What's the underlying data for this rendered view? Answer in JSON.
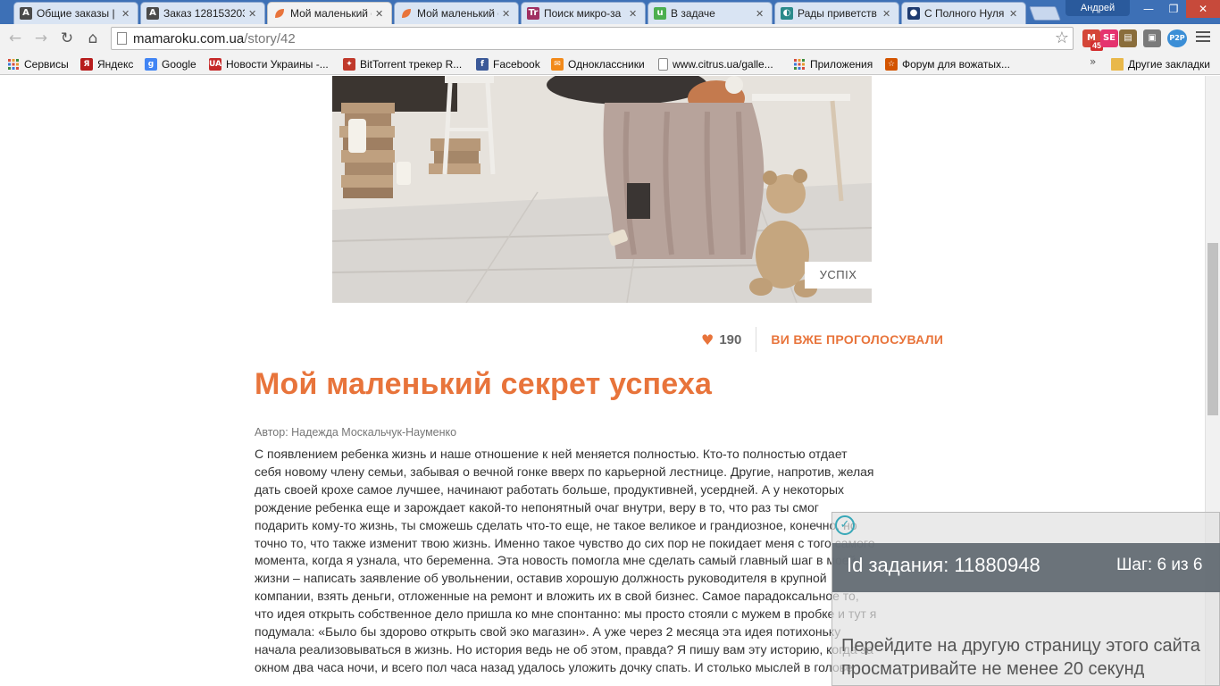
{
  "browser": {
    "tabs": [
      {
        "title": "Общие заказы | ",
        "icon": "A",
        "color": "#4a4a4a",
        "active": false
      },
      {
        "title": "Заказ 128153203",
        "icon": "A",
        "color": "#4a4a4a",
        "active": false
      },
      {
        "title": "Мой маленький с",
        "icon": "leaf",
        "color": "#e8743b",
        "active": true
      },
      {
        "title": "Мой маленький с",
        "icon": "leaf",
        "color": "#e8743b",
        "active": false
      },
      {
        "title": "Поиск микро-за",
        "icon": "Tr",
        "color": "#a03062",
        "active": false
      },
      {
        "title": "В задаче",
        "icon": "u",
        "color": "#4caf50",
        "active": false
      },
      {
        "title": "Рады приветств",
        "icon": "◐",
        "color": "#2a8a8a",
        "active": false
      },
      {
        "title": "С Полного Нуля",
        "icon": "●",
        "color": "#1e3b70",
        "active": false
      }
    ],
    "profile_name": "Андрей",
    "url_host": "mamaroku.com.ua",
    "url_path": "/story/42",
    "extensions": [
      {
        "label": "M",
        "color": "#d44638",
        "badge": "45"
      },
      {
        "label": "SE",
        "color": "#e5336f",
        "badge": ""
      },
      {
        "label": "▤",
        "color": "#8a6d3b",
        "badge": ""
      },
      {
        "label": "▣",
        "color": "#7a7a7a",
        "badge": ""
      },
      {
        "label": "P2P",
        "color": "#3b8ed6",
        "badge": ""
      }
    ],
    "bookmarks": [
      {
        "label": "Сервисы",
        "icon": "grid",
        "color": "#d54b3d"
      },
      {
        "label": "Яндекс",
        "icon": "Я",
        "color": "#b71c1c"
      },
      {
        "label": "Google",
        "icon": "g",
        "color": "#4285f4"
      },
      {
        "label": "Новости Украины -...",
        "icon": "UA",
        "color": "#c62828"
      },
      {
        "label": "BitTorrent трекер R...",
        "icon": "✦",
        "color": "#c0392b"
      },
      {
        "label": "Facebook",
        "icon": "f",
        "color": "#3b5998"
      },
      {
        "label": "Одноклассники",
        "icon": "✉",
        "color": "#f28a1a"
      },
      {
        "label": "www.citrus.ua/galle...",
        "icon": "doc",
        "color": "#ffffff"
      },
      {
        "label": "Приложения",
        "icon": "grid",
        "color": "#d54b3d"
      },
      {
        "label": "Форум для вожатых...",
        "icon": "☆",
        "color": "#d35400"
      }
    ],
    "bookmarks_more": "»",
    "other_bookmarks": "Другие закладки"
  },
  "story": {
    "tag": "УСПІХ",
    "votes": "190",
    "voted_label": "ВИ ВЖЕ ПРОГОЛОСУВАЛИ",
    "title": "Мой маленький секрет успеха",
    "author": "Автор: Надежда Москальчук-Науменко",
    "lines": [
      "С появлением ребенка жизнь и наше отношение к ней меняется полностью. Кто-то полностью отдает",
      "себя новому члену семьи, забывая о вечной гонке вверх по карьерной лестнице. Другие, напротив, желая",
      "дать своей крохе самое лучшее, начинают работать больше, продуктивней, усердней. А у некоторых",
      "рождение ребенка еще и зарождает какой-то непонятный очаг внутри, веру в то, что раз ты смог",
      "подарить кому-то жизнь, ты сможешь сделать что-то еще, не такое великое и грандиозное, конечно, но",
      "точно то, что также изменит твою жизнь. Именно такое чувство до сих пор не покидает меня с того самого",
      "момента, когда я узнала, что беременна. Эта новость помогла мне сделать самый главный шаг в моей",
      "жизни – написать заявление об увольнении, оставив хорошую должность руководителя в крупной",
      "компании, взять деньги, отложенные на ремонт и вложить их в свой бизнес. Самое парадоксальное то,",
      "что идея открыть собственное дело пришла ко мне спонтанно: мы просто стояли с мужем в пробке и тут я",
      "подумала: «Было бы здорово открыть свой эко магазин». А уже через 2 месяца эта идея потихоньку",
      "начала реализовываться в жизнь. Но история ведь не об этом, правда? Я пишу вам эту историю, когда за",
      "окном два часа ночи, и всего пол часа назад удалось уложить дочку спать. И столько мыслей в голове"
    ]
  },
  "task_overlay": {
    "id_label": "Id задания: 11880948",
    "step_label": "Шаг: 6 из 6",
    "instruction_line1": "Перейдите на другую страницу этого сайта",
    "instruction_line2": "просматривайте не менее 20 секунд"
  },
  "colors": {
    "accent": "#e8743b",
    "tabstrip": "#3d70b6",
    "overlay_bar": "#5f6870"
  }
}
